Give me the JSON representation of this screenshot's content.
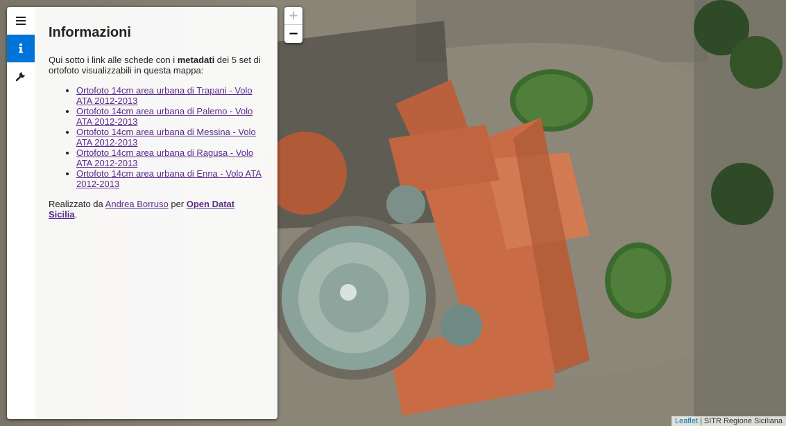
{
  "sidebar": {
    "tabs": [
      {
        "icon": "menu-icon",
        "active": false
      },
      {
        "icon": "info-icon",
        "active": true
      },
      {
        "icon": "wrench-icon",
        "active": false
      }
    ],
    "title": "Informazioni",
    "intro": {
      "before": "Qui sotto i link alle schede con i ",
      "bold": "metadati",
      "after": " dei 5 set di ortofoto visualizzabili in questa mappa:"
    },
    "links": [
      "Ortofoto 14cm area urbana di Trapani - Volo ATA 2012-2013",
      "Ortofoto 14cm area urbana di Palemo - Volo ATA 2012-2013",
      "Ortofoto 14cm area urbana di Messina - Volo ATA 2012-2013",
      "Ortofoto 14cm area urbana di Ragusa - Volo ATA 2012-2013",
      "Ortofoto 14cm area urbana di Enna - Volo ATA 2012-2013"
    ],
    "credits": {
      "prefix": "Realizzato da ",
      "author": "Andrea Borruso",
      "middle": " per ",
      "org": "Open Datat Sicilia",
      "suffix": "."
    }
  },
  "zoom": {
    "in_label": "+",
    "out_label": "−"
  },
  "attribution": {
    "leaflet": "Leaflet",
    "separator": " | ",
    "source": "SITR Regione Siciliana"
  },
  "colors": {
    "accent": "#0074d9",
    "link": "#5b2a8c",
    "attribution_link": "#0078a8"
  }
}
